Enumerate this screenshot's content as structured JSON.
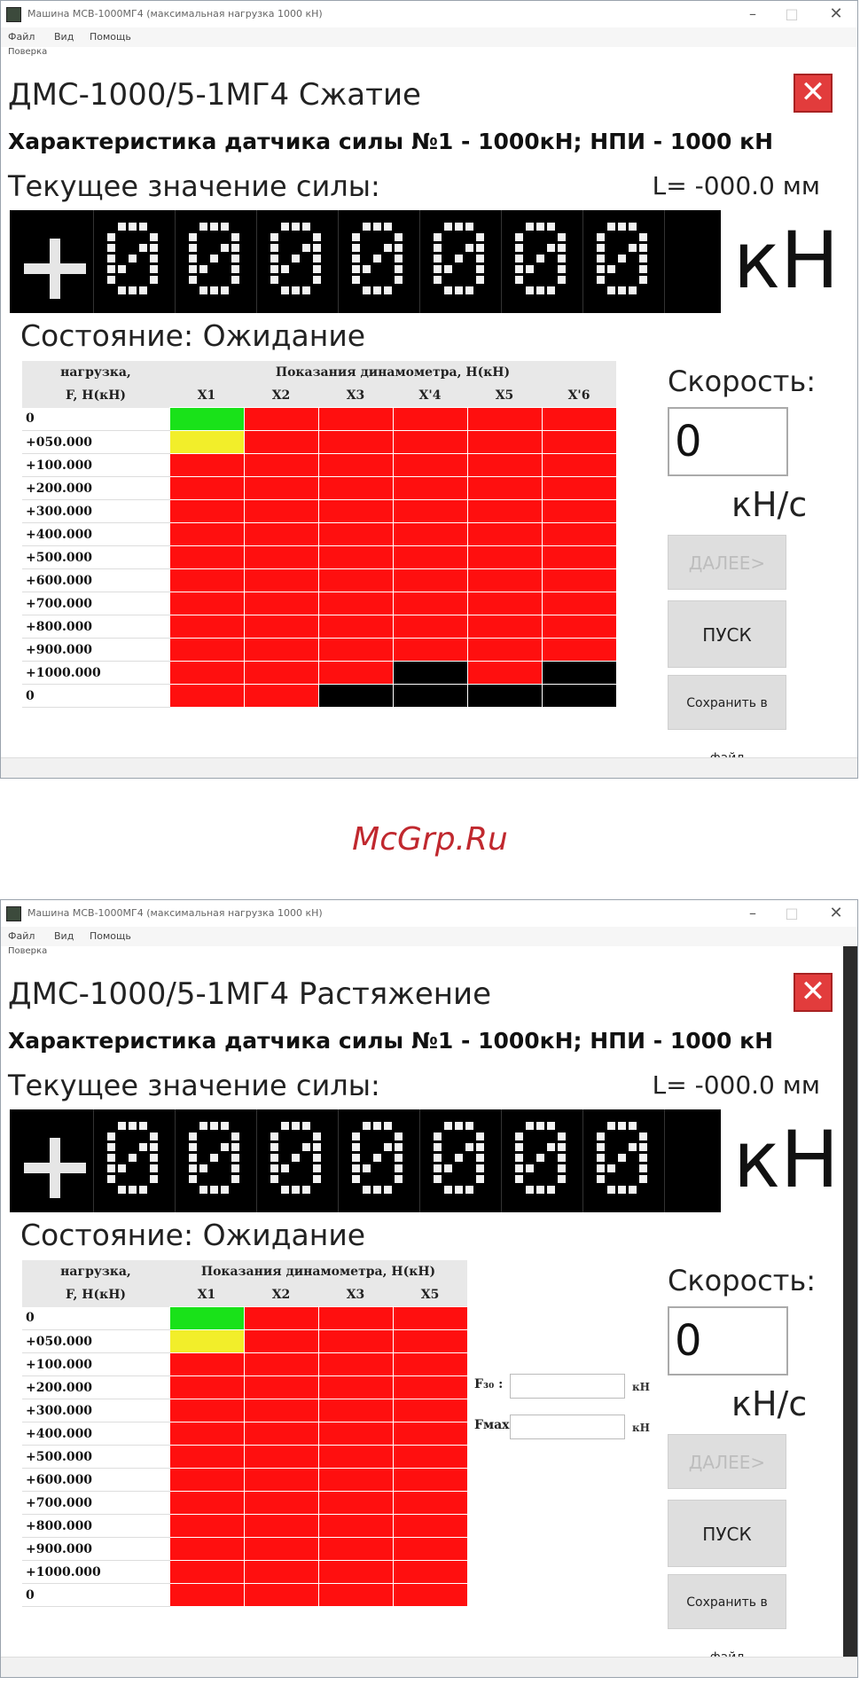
{
  "window_title": "Машина МСВ-1000МГ4 (максимальная нагрузка 1000 кН)",
  "menu": [
    "Файл",
    "Вид",
    "Помощь"
  ],
  "sub_label": "Поверка",
  "window_controls": {
    "minimize": "–",
    "maximize": "□",
    "close": "✕"
  },
  "panels": [
    {
      "device_title": "ДМС-1000/5-1МГ4 Сжатие",
      "close_symbol": "✕",
      "sensor_line": "Характеристика датчика силы №1 - 1000кН; НПИ - 1000 кН",
      "current_label": "Текущее значение силы:",
      "l_value": "L= -000.0 мм",
      "display_value": "+0000.000",
      "display_unit": "кН",
      "status": "Состояние: Ожидание",
      "table": {
        "load_header": [
          "нагрузка,",
          "F, Н(кН)"
        ],
        "reading_header": "Показания динамометра, Н(кН)",
        "columns": [
          "X1",
          "X2",
          "X3",
          "X'4",
          "X5",
          "X'6"
        ],
        "loads": [
          "0",
          "+050.000",
          "+100.000",
          "+200.000",
          "+300.000",
          "+400.000",
          "+500.000",
          "+600.000",
          "+700.000",
          "+800.000",
          "+900.000",
          "+1000.000",
          "0"
        ],
        "cell_states": [
          [
            "green",
            "red",
            "red",
            "red",
            "red",
            "red"
          ],
          [
            "yellow",
            "red",
            "red",
            "red",
            "red",
            "red"
          ],
          [
            "red",
            "red",
            "red",
            "red",
            "red",
            "red"
          ],
          [
            "red",
            "red",
            "red",
            "red",
            "red",
            "red"
          ],
          [
            "red",
            "red",
            "red",
            "red",
            "red",
            "red"
          ],
          [
            "red",
            "red",
            "red",
            "red",
            "red",
            "red"
          ],
          [
            "red",
            "red",
            "red",
            "red",
            "red",
            "red"
          ],
          [
            "red",
            "red",
            "red",
            "red",
            "red",
            "red"
          ],
          [
            "red",
            "red",
            "red",
            "red",
            "red",
            "red"
          ],
          [
            "red",
            "red",
            "red",
            "red",
            "red",
            "red"
          ],
          [
            "red",
            "red",
            "red",
            "red",
            "red",
            "red"
          ],
          [
            "red",
            "red",
            "red",
            "black",
            "red",
            "black"
          ],
          [
            "red",
            "red",
            "black",
            "black",
            "black",
            "black"
          ]
        ]
      },
      "speed_label": "Скорость:",
      "speed_value": "0",
      "speed_unit": "кН/с",
      "buttons": {
        "next": "ДАЛЕЕ>",
        "start": "ПУСК",
        "save": "Сохранить в файл"
      }
    },
    {
      "device_title": "ДМС-1000/5-1МГ4  Растяжение",
      "close_symbol": "✕",
      "sensor_line": "Характеристика датчика силы №1 - 1000кН; НПИ - 1000 кН",
      "current_label": "Текущее значение силы:",
      "l_value": "L= -000.0 мм",
      "display_value": "+0000.000",
      "display_unit": "кН",
      "status": "Состояние: Ожидание",
      "table": {
        "load_header": [
          "нагрузка,",
          "F, Н(кН)"
        ],
        "reading_header": "Показания динамометра, Н(кН)",
        "columns": [
          "X1",
          "X2",
          "X3",
          "X5"
        ],
        "loads": [
          "0",
          "+050.000",
          "+100.000",
          "+200.000",
          "+300.000",
          "+400.000",
          "+500.000",
          "+600.000",
          "+700.000",
          "+800.000",
          "+900.000",
          "+1000.000",
          "0"
        ],
        "cell_states": [
          [
            "green",
            "red",
            "red",
            "red"
          ],
          [
            "yellow",
            "red",
            "red",
            "red"
          ],
          [
            "red",
            "red",
            "red",
            "red"
          ],
          [
            "red",
            "red",
            "red",
            "red"
          ],
          [
            "red",
            "red",
            "red",
            "red"
          ],
          [
            "red",
            "red",
            "red",
            "red"
          ],
          [
            "red",
            "red",
            "red",
            "red"
          ],
          [
            "red",
            "red",
            "red",
            "red"
          ],
          [
            "red",
            "red",
            "red",
            "red"
          ],
          [
            "red",
            "red",
            "red",
            "red"
          ],
          [
            "red",
            "red",
            "red",
            "red"
          ],
          [
            "red",
            "red",
            "red",
            "red"
          ],
          [
            "red",
            "red",
            "red",
            "red"
          ]
        ]
      },
      "aux_fields": [
        {
          "label": "F₃₀ :",
          "unit": "кН"
        },
        {
          "label": "Fмах:",
          "unit": "кН"
        }
      ],
      "speed_label": "Скорость:",
      "speed_value": "0",
      "speed_unit": "кН/с",
      "buttons": {
        "next": "ДАЛЕЕ>",
        "start": "ПУСК",
        "save": "Сохранить в файл"
      }
    }
  ],
  "watermark": "McGrp.Ru"
}
